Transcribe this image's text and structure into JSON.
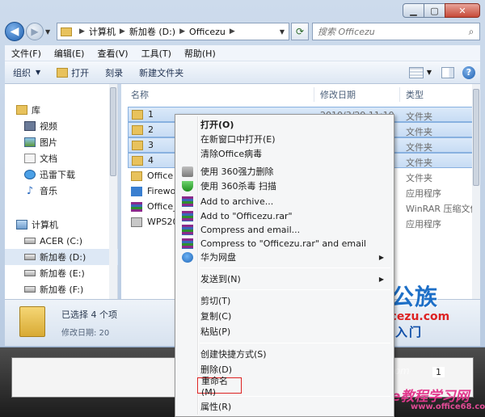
{
  "address": {
    "crumbs": [
      "计算机",
      "新加卷 (D:)",
      "Officezu"
    ],
    "search_placeholder": "搜索 Officezu"
  },
  "menubar": [
    "文件(F)",
    "编辑(E)",
    "查看(V)",
    "工具(T)",
    "帮助(H)"
  ],
  "commands": {
    "organize": "组织",
    "open": "打开",
    "burn": "刻录",
    "new_folder": "新建文件夹"
  },
  "navpane": {
    "libraries": "库",
    "video": "视频",
    "pictures": "图片",
    "documents": "文档",
    "xunlei": "迅雷下载",
    "music": "音乐",
    "computer": "计算机",
    "drive_c": "ACER (C:)",
    "drive_d": "新加卷 (D:)",
    "drive_e": "新加卷 (E:)",
    "drive_f": "新加卷 (F:)"
  },
  "columns": {
    "name": "名称",
    "date": "修改日期",
    "type": "类型"
  },
  "files": [
    {
      "name": "1",
      "type": "文件夹",
      "icon": "folder-icon",
      "selected": true
    },
    {
      "name": "2",
      "type": "文件夹",
      "icon": "folder-icon",
      "selected": true
    },
    {
      "name": "3",
      "type": "文件夹",
      "icon": "folder-icon",
      "selected": true
    },
    {
      "name": "4",
      "type": "文件夹",
      "icon": "folder-icon",
      "selected": true
    },
    {
      "name": "Office",
      "type": "文件夹",
      "icon": "folder-icon",
      "selected": false
    },
    {
      "name": "Firewo",
      "type": "应用程序",
      "icon": "app-icon",
      "selected": false
    },
    {
      "name": "Office_",
      "type": "WinRAR 压缩文件",
      "icon": "rar-icon",
      "selected": false
    },
    {
      "name": "WPS20",
      "type": "应用程序",
      "icon": "wps-icon",
      "selected": false
    }
  ],
  "first_date_partial": "2010/3/29 11:10",
  "details": {
    "selection": "已选择 4 个项",
    "date_label": "修改日期: 20"
  },
  "context_menu": {
    "open": "打开(O)",
    "open_new_window": "在新窗口中打开(E)",
    "clear_virus": "清除Office病毒",
    "force_delete_360": "使用 360强力删除",
    "scan_360": "使用 360杀毒 扫描",
    "add_archive": "Add to archive...",
    "add_rar": "Add to \"Officezu.rar\"",
    "compress_email": "Compress and email...",
    "compress_rar_email": "Compress to \"Officezu.rar\" and email",
    "huawei_disk": "华为网盘",
    "send_to": "发送到(N)",
    "cut": "剪切(T)",
    "copy": "复制(C)",
    "paste": "粘贴(P)",
    "create_shortcut": "创建快捷方式(S)",
    "delete": "删除(D)",
    "rename": "重命名(M)",
    "properties": "属性(R)"
  },
  "page_number": "1",
  "watermark": {
    "logo": "办公族",
    "url": "Officezu.com",
    "tagline": "电脑入门",
    "mid": "officezu.com",
    "bottom": "Office教程学习网",
    "bottom_url": "www.office68.com"
  }
}
